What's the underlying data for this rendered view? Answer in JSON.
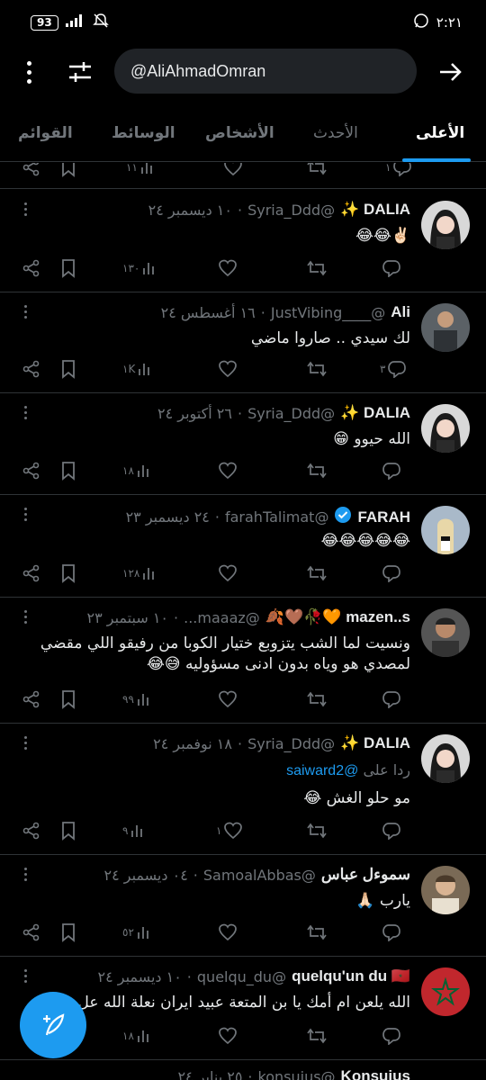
{
  "status_bar": {
    "battery": "93",
    "time": "٢:٢١"
  },
  "search": {
    "query": "@AliAhmadOmran"
  },
  "tabs": [
    {
      "label": "الأعلى",
      "active": true
    },
    {
      "label": "الأحدث",
      "active": false
    },
    {
      "label": "الأشخاص",
      "active": false
    },
    {
      "label": "الوسائط",
      "active": false
    },
    {
      "label": "القوائم",
      "active": false
    }
  ],
  "tweets": [
    {
      "name": "DALIA ✨",
      "handle": "@Syria_Ddd",
      "date": "١٠ ديسمبر ٢٤",
      "text": "✌🏻😂😂",
      "counts": {
        "replies": "",
        "retweets": "",
        "likes": "",
        "views": "١٣٠"
      }
    },
    {
      "name": "Ali",
      "handle": "@____JustVibing",
      "date": "١٦ أغسطس ٢٤",
      "text": "لك سيدي .. صاروا ماضي",
      "counts": {
        "replies": "٣",
        "retweets": "",
        "likes": "",
        "views": "١K"
      }
    },
    {
      "name": "DALIA ✨",
      "handle": "@Syria_Ddd",
      "date": "٢٦ أكتوبر ٢٤",
      "text": "الله حيوو 😁",
      "counts": {
        "replies": "",
        "retweets": "",
        "likes": "",
        "views": "١٨"
      }
    },
    {
      "name": "FARAH",
      "handle": "@farahTalimat",
      "date": "٢٤ ديسمبر ٢٣",
      "verified": true,
      "text": "😂😂😂😂😂",
      "counts": {
        "replies": "",
        "retweets": "",
        "likes": "",
        "views": "١٢٨"
      }
    },
    {
      "name": "mazen..s 🧡🥀🤎🍂",
      "handle": "@maaaz...",
      "date": "١٠ سبتمبر ٢٣",
      "text_lines": [
        "ونسيت لما الشب يتزوبع ختيار الكوبا من رفيقو اللي مقضي",
        "لمصدي هو وياه بدون ادنى مسؤوليه 😅😂"
      ],
      "counts": {
        "replies": "",
        "retweets": "",
        "likes": "",
        "views": "٩٩"
      }
    },
    {
      "name": "DALIA ✨",
      "handle": "@Syria_Ddd",
      "date": "١٨ نوفمبر ٢٤",
      "reply_prefix": "ردا على",
      "reply_to": "@saiward2",
      "text": "مو حلو الغش 😂",
      "counts": {
        "replies": "",
        "retweets": "",
        "likes": "١",
        "views": "٩"
      }
    },
    {
      "name": "سموءل عباس",
      "handle": "@SamoalAbbas",
      "date": "٠٤ ديسمبر ٢٤",
      "text": "يارب 🙏🏻",
      "counts": {
        "replies": "",
        "retweets": "",
        "likes": "",
        "views": "٥٢"
      }
    },
    {
      "name": "quelqu'un du 🇲🇦",
      "handle": "@quelqu_du",
      "date": "١٠ ديسمبر ٢٤",
      "text": "الله يلعن ام أمك يا بن المتعة عبيد ايران نعلة الله عل",
      "counts": {
        "replies": "",
        "retweets": "",
        "likes": "",
        "views": "١٨"
      }
    }
  ],
  "partial_prev": {
    "replies": "١",
    "views": "١١"
  },
  "partial_next": {
    "name": "Konsuius",
    "handle": "@konsuius",
    "date": "٢٥ يناير ٢٤"
  },
  "colors": {
    "accent": "#1d9bf0",
    "background": "#000000",
    "muted": "#71767b"
  }
}
